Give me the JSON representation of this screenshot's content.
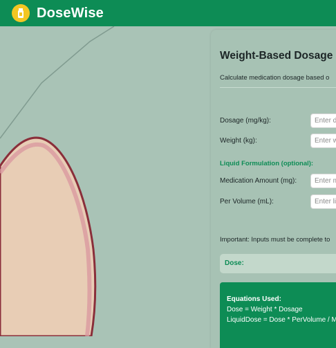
{
  "app": {
    "name": "DoseWise",
    "brand_color": "#0d8c55",
    "logo_color": "#f3c623",
    "logo_icon": "medicine-bottle-icon"
  },
  "calculator": {
    "title": "Weight-Based Dosage C",
    "subtitle": "Calculate medication dosage based o",
    "fields": {
      "dosage": {
        "label": "Dosage (mg/kg):",
        "placeholder": "Enter d",
        "value": ""
      },
      "weight": {
        "label": "Weight (kg):",
        "placeholder": "Enter w",
        "value": ""
      },
      "medication_amount": {
        "label": "Medication Amount (mg):",
        "placeholder": "Enter m",
        "value": ""
      },
      "per_volume": {
        "label": "Per Volume (mL):",
        "placeholder": "Enter li",
        "value": ""
      }
    },
    "liquid_section_label": "Liquid Formulation (optional):",
    "important_note": "Important: Inputs must be complete to",
    "result": {
      "label": "Dose:"
    },
    "equations": {
      "title": "Equations Used:",
      "lines": [
        "Dose = Weight * Dosage",
        "LiquidDose = Dose * PerVolume / M"
      ]
    }
  }
}
